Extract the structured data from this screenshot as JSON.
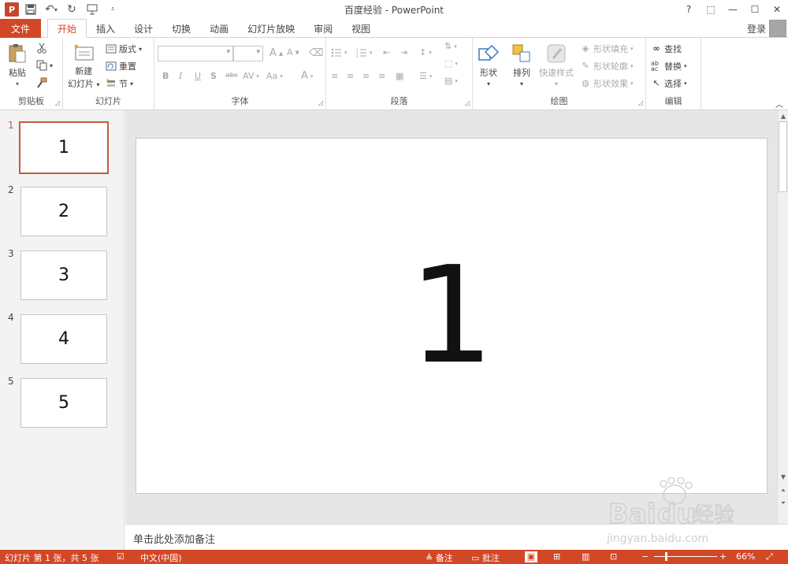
{
  "window": {
    "title": "百度经验 - PowerPoint",
    "controls": [
      "?",
      "⬚",
      "—",
      "☐",
      "✕"
    ]
  },
  "tabs": {
    "file": "文件",
    "items": [
      "开始",
      "插入",
      "设计",
      "切换",
      "动画",
      "幻灯片放映",
      "审阅",
      "视图"
    ],
    "active_index": 0,
    "login": "登录"
  },
  "ribbon": {
    "clipboard": {
      "label": "剪贴板",
      "paste": "粘贴"
    },
    "slides": {
      "label": "幻灯片",
      "new_slide_line1": "新建",
      "new_slide_line2": "幻灯片",
      "layout": "版式",
      "reset": "重置",
      "section": "节"
    },
    "font": {
      "label": "字体"
    },
    "paragraph": {
      "label": "段落"
    },
    "drawing": {
      "label": "绘图",
      "shapes": "形状",
      "arrange": "排列",
      "quick_styles": "快速样式",
      "fill": "形状填充",
      "outline": "形状轮廓",
      "effects": "形状效果"
    },
    "editing": {
      "label": "编辑",
      "find": "查找",
      "replace": "替换",
      "select": "选择"
    }
  },
  "slides": {
    "thumbnails": [
      {
        "number": "1",
        "text": "1"
      },
      {
        "number": "2",
        "text": "2"
      },
      {
        "number": "3",
        "text": "3"
      },
      {
        "number": "4",
        "text": "4"
      },
      {
        "number": "5",
        "text": "5"
      }
    ],
    "selected_index": 0,
    "current_slide_text": "1"
  },
  "notes": {
    "placeholder": "单击此处添加备注"
  },
  "status": {
    "slide_info": "幻灯片 第 1 张，共 5 张",
    "language": "中文(中国)",
    "notes_btn": "备注",
    "comments_btn": "批注",
    "zoom": "66%"
  },
  "colors": {
    "accent": "#d24726",
    "slide_border_selected": "#c65a3a"
  },
  "watermark": {
    "brand": "Bai",
    "brand2": "du",
    "brand_cn": "经验",
    "url": "jingyan.baidu.com"
  }
}
